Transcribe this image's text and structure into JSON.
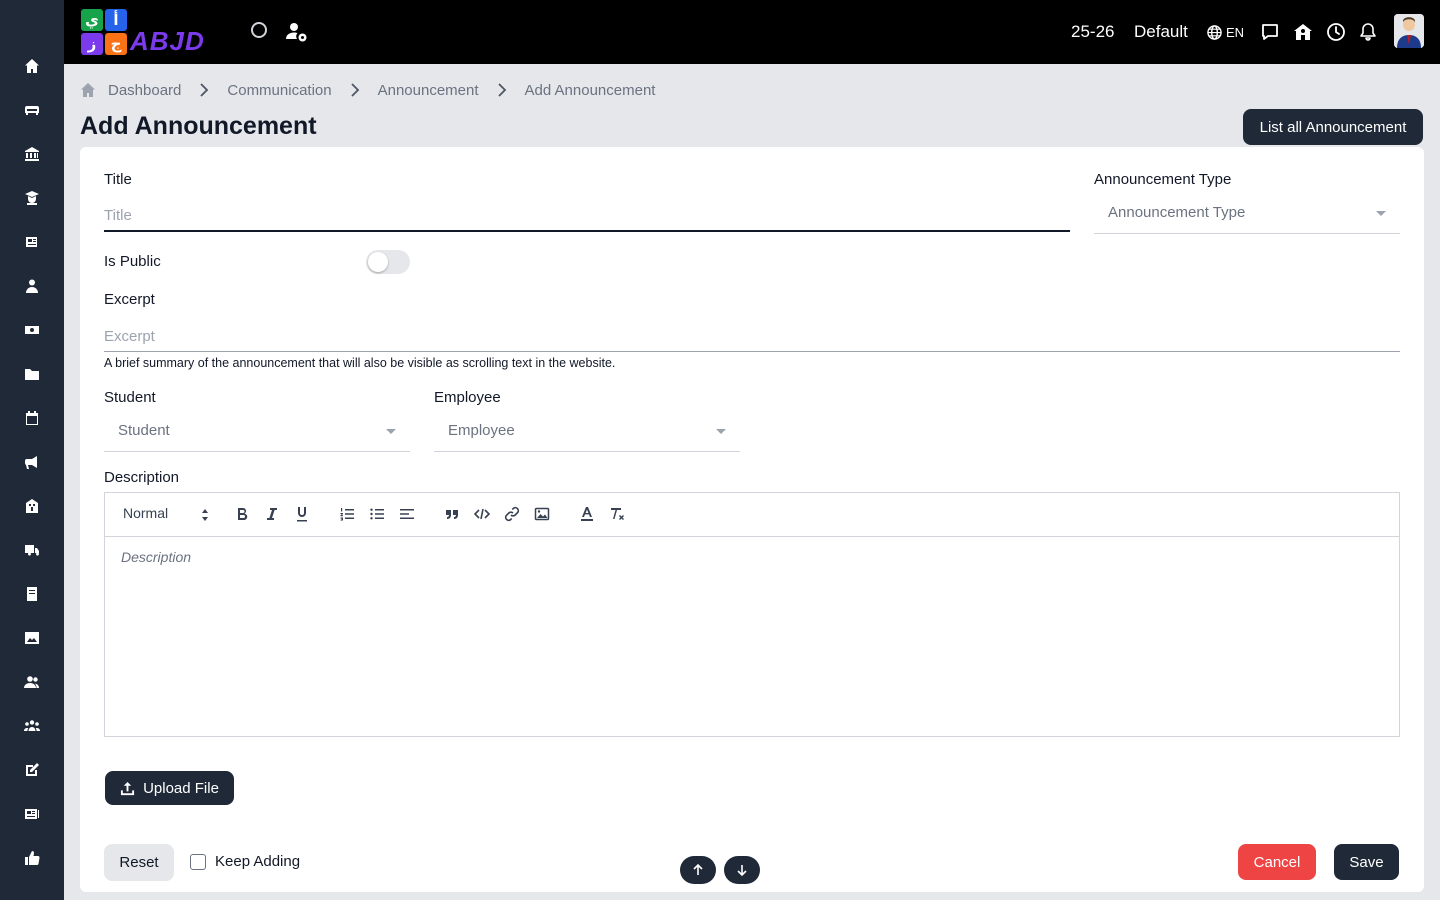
{
  "sidebar": {
    "items": [
      {
        "icon": "home-icon"
      },
      {
        "icon": "sofa-icon"
      },
      {
        "icon": "bank-icon"
      },
      {
        "icon": "graduate-icon"
      },
      {
        "icon": "newspaper-icon"
      },
      {
        "icon": "teacher-icon"
      },
      {
        "icon": "money-icon"
      },
      {
        "icon": "folder-icon"
      },
      {
        "icon": "calendar-icon"
      },
      {
        "icon": "megaphone-icon"
      },
      {
        "icon": "school-icon"
      },
      {
        "icon": "truck-icon"
      },
      {
        "icon": "book-icon"
      },
      {
        "icon": "image-icon"
      },
      {
        "icon": "users-icon"
      },
      {
        "icon": "people-group-icon"
      },
      {
        "icon": "edit-icon"
      },
      {
        "icon": "news-icon"
      },
      {
        "icon": "thumbs-up-icon"
      }
    ]
  },
  "topbar": {
    "logo_top": [
      "ي",
      "أ"
    ],
    "logo_bottom": [
      "ز",
      "ج"
    ],
    "logo_word": "ABJD",
    "year": "25-26",
    "profile": "Default",
    "language": "EN"
  },
  "breadcrumb": {
    "items": [
      "Dashboard",
      "Communication",
      "Announcement",
      "Add Announcement"
    ]
  },
  "page": {
    "title": "Add Announcement",
    "list_button": "List all Announcement"
  },
  "form": {
    "title_label": "Title",
    "title_placeholder": "Title",
    "type_label": "Announcement Type",
    "type_value": "Announcement Type",
    "is_public_label": "Is Public",
    "is_public": false,
    "excerpt_label": "Excerpt",
    "excerpt_placeholder": "Excerpt",
    "excerpt_help": "A brief summary of the announcement that will also be visible as scrolling text in the website.",
    "student_label": "Student",
    "student_value": "Student",
    "employee_label": "Employee",
    "employee_value": "Employee",
    "description_label": "Description",
    "editor_format": "Normal",
    "description_placeholder": "Description",
    "upload_label": "Upload File",
    "reset_label": "Reset",
    "keep_adding_label": "Keep Adding",
    "cancel_label": "Cancel",
    "save_label": "Save"
  },
  "colors": {
    "sidebar": "#1f2937",
    "topbar": "#000000",
    "primary": "#1f2937",
    "danger": "#ef4444",
    "background": "#e5e7eb"
  }
}
